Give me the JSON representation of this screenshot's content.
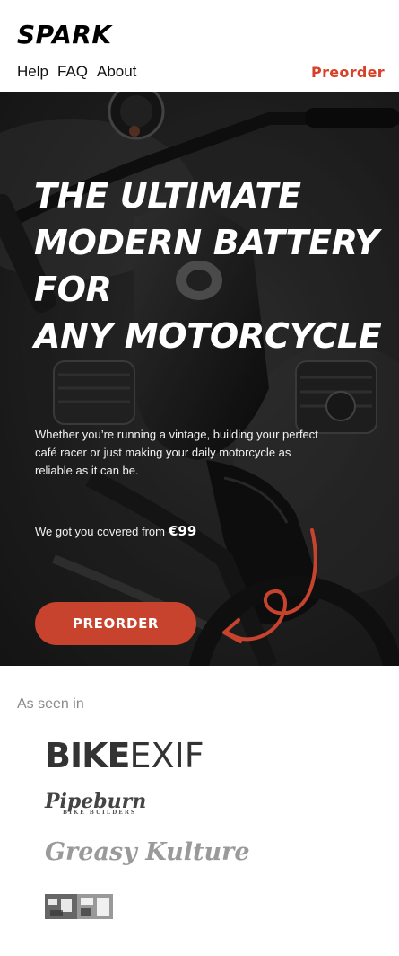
{
  "header": {
    "brand": "SPARK",
    "nav": [
      {
        "label": "Help"
      },
      {
        "label": "FAQ"
      },
      {
        "label": "About"
      }
    ],
    "preorder_link": "Preorder"
  },
  "hero": {
    "title_lines": [
      "THE ULTIMATE",
      "MODERN BATTERY",
      "FOR",
      "ANY MOTORCYCLE"
    ],
    "description": "Whether you’re running a vintage, building your perfect café racer or just making your daily motorcycle as reliable as it can be.",
    "price_prefix": "We got you covered from",
    "price": "€99",
    "cta_label": "PREORDER"
  },
  "press": {
    "label": "As seen in",
    "logos": {
      "bikeexif_bold": "BIKE",
      "bikeexif_light": "EXIF",
      "pipeburn": "Pipeburn",
      "pipeburn_sub": "BIKE BUILDERS",
      "greasy_kulture": "Greasy Kulture"
    }
  },
  "colors": {
    "accent": "#d8402a",
    "button": "#c8432e",
    "hero_bg": "#2a2a2a"
  }
}
